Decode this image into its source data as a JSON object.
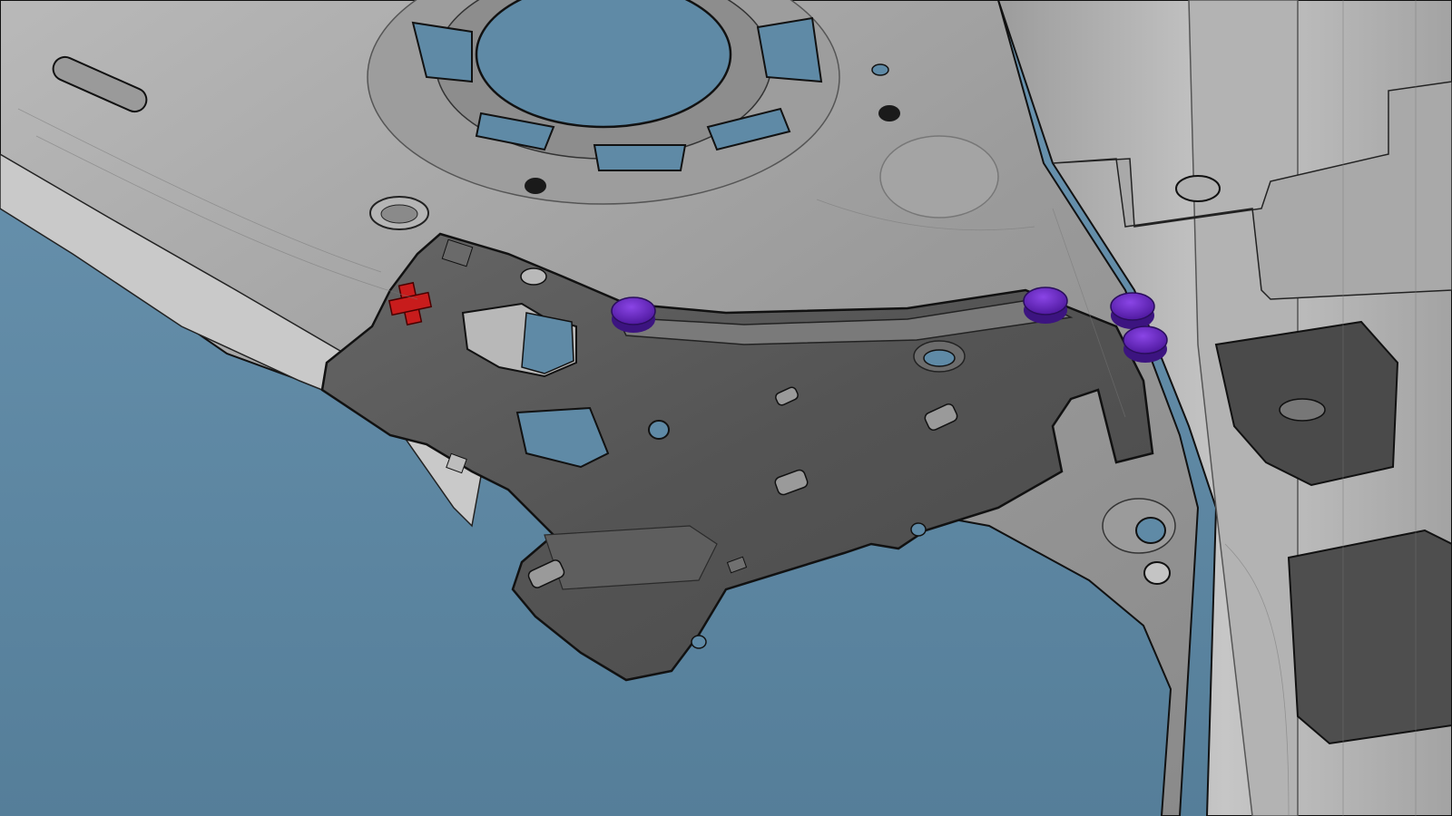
{
  "viewport": {
    "background_color": "#5f8aa6",
    "panel_light_color": "#a8a8a8",
    "panel_mid_color": "#8f8f8f",
    "bracket_color": "#5a5a5a",
    "bracket_dark_color": "#464646",
    "weld_marker_color": "#5b1fb0",
    "weld_marker_top_color": "#7a35d8",
    "datum_marker_color": "#c81c1c"
  },
  "markers": {
    "weld_points": [
      {
        "name": "weld-point-1"
      },
      {
        "name": "weld-point-2"
      },
      {
        "name": "weld-point-3"
      },
      {
        "name": "weld-point-4"
      }
    ],
    "datum": {
      "name": "datum-cross-marker"
    }
  }
}
